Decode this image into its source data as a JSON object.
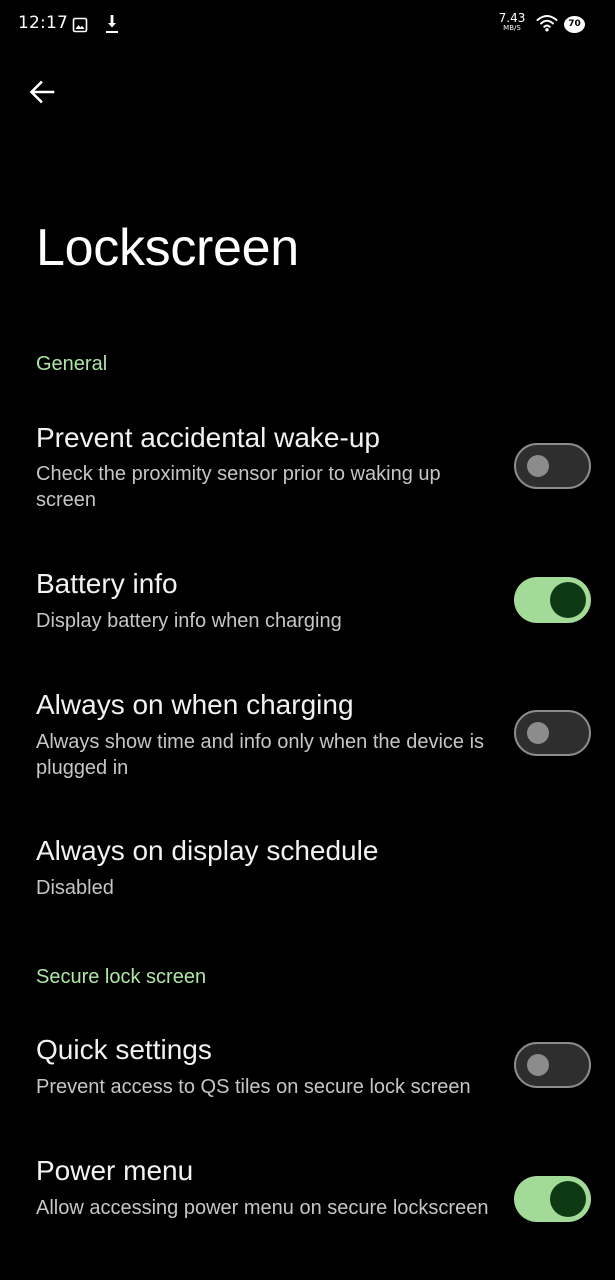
{
  "status_bar": {
    "time": "12:17",
    "net_speed": "7.43",
    "net_speed_unit": "MB/S",
    "battery_level": "70",
    "icons": [
      "image-icon",
      "download-icon",
      "wifi-icon",
      "battery-icon"
    ]
  },
  "header": {
    "back_icon": "arrow-back-icon",
    "title": "Lockscreen"
  },
  "sections": [
    {
      "title": "General",
      "items": [
        {
          "title": "Prevent accidental wake-up",
          "summary": "Check the proximity sensor prior to waking up screen",
          "switch": false
        },
        {
          "title": "Battery info",
          "summary": "Display battery info when charging",
          "switch": true
        },
        {
          "title": "Always on when charging",
          "summary": "Always show time and info only when the device is plugged in",
          "switch": false
        },
        {
          "title": "Always on display schedule",
          "summary": "Disabled"
        }
      ]
    },
    {
      "title": "Secure lock screen",
      "items": [
        {
          "title": "Quick settings",
          "summary": "Prevent access to QS tiles on secure lock screen",
          "switch": false
        },
        {
          "title": "Power menu",
          "summary": "Allow accessing power menu on secure lockscreen",
          "switch": true
        }
      ]
    }
  ],
  "colors": {
    "background": "#000000",
    "accent": "#aee6a4",
    "switch_on_track": "#a3da98",
    "switch_on_thumb": "#0d3a12",
    "switch_off_outline": "#8c8c8c"
  }
}
